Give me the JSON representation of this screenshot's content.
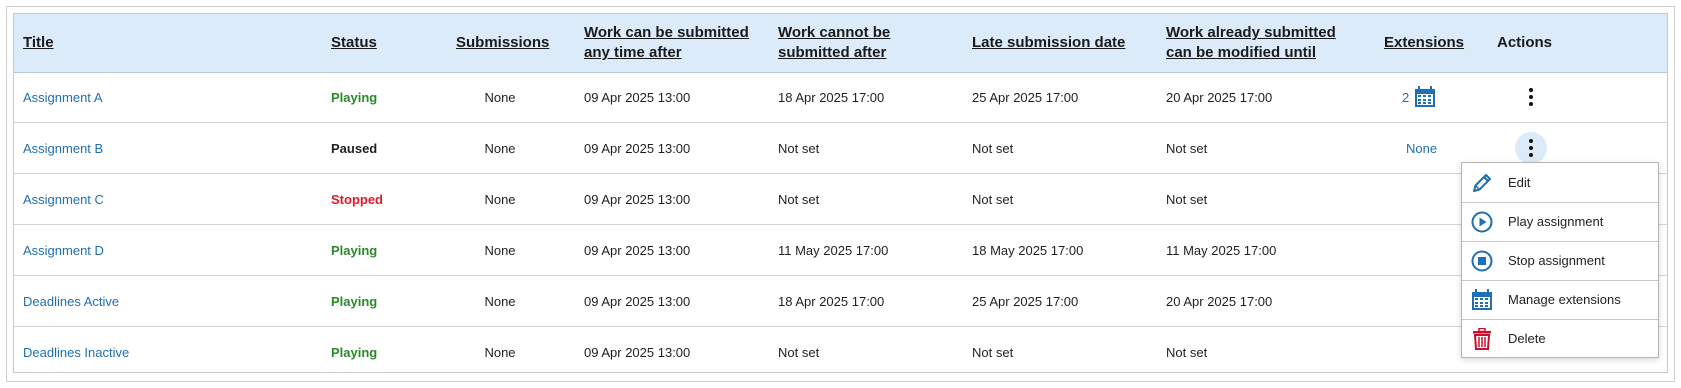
{
  "colors": {
    "link": "#1f6fb2",
    "header_bg": "#dcebfa",
    "playing": "#2a8a2a",
    "paused": "#1f1f1f",
    "stopped": "#e0192a",
    "icon_blue": "#1f6fb2",
    "delete_red": "#c8102e"
  },
  "headers": {
    "title": "Title",
    "status": "Status",
    "submissions": "Submissions",
    "start_line1": "Work can be submitted",
    "start_line2": "any time after",
    "end_line1": "Work cannot be",
    "end_line2": "submitted after",
    "late": "Late submission date",
    "modify_line1": "Work already submitted",
    "modify_line2": "can be modified until",
    "extensions": "Extensions",
    "actions": "Actions"
  },
  "rows": [
    {
      "title": "Assignment A",
      "status": "Playing",
      "status_color": "#2a8a2a",
      "submissions": "None",
      "start": "09 Apr 2025 13:00",
      "end": "18 Apr 2025 17:00",
      "late": "25 Apr 2025 17:00",
      "modify": "20 Apr 2025 17:00",
      "extensions": "2",
      "extension_icon": "calendar-icon"
    },
    {
      "title": "Assignment B",
      "status": "Paused",
      "status_color": "#1f1f1f",
      "submissions": "None",
      "start": "09 Apr 2025 13:00",
      "end": "Not set",
      "late": "Not set",
      "modify": "Not set",
      "extensions": "None"
    },
    {
      "title": "Assignment C",
      "status": "Stopped",
      "status_color": "#e0192a",
      "submissions": "None",
      "start": "09 Apr 2025 13:00",
      "end": "Not set",
      "late": "Not set",
      "modify": "Not set",
      "extensions": ""
    },
    {
      "title": "Assignment D",
      "status": "Playing",
      "status_color": "#2a8a2a",
      "submissions": "None",
      "start": "09 Apr 2025 13:00",
      "end": "11 May 2025 17:00",
      "late": "18 May 2025 17:00",
      "modify": "11 May 2025 17:00",
      "extensions": ""
    },
    {
      "title": "Deadlines Active",
      "status": "Playing",
      "status_color": "#2a8a2a",
      "submissions": "None",
      "start": "09 Apr 2025 13:00",
      "end": "18 Apr 2025 17:00",
      "late": "25 Apr 2025 17:00",
      "modify": "20 Apr 2025 17:00",
      "extensions": ""
    },
    {
      "title": "Deadlines Inactive",
      "status": "Playing",
      "status_color": "#2a8a2a",
      "submissions": "None",
      "start": "09 Apr 2025 13:00",
      "end": "Not set",
      "late": "Not set",
      "modify": "Not set",
      "extensions": ""
    }
  ],
  "menu": {
    "items": [
      {
        "label": "Edit",
        "icon": "pencil-icon"
      },
      {
        "label": "Play assignment",
        "icon": "play-icon"
      },
      {
        "label": "Stop assignment",
        "icon": "stop-icon"
      },
      {
        "label": "Manage extensions",
        "icon": "calendar-icon"
      },
      {
        "label": "Delete",
        "icon": "trash-icon"
      }
    ]
  }
}
